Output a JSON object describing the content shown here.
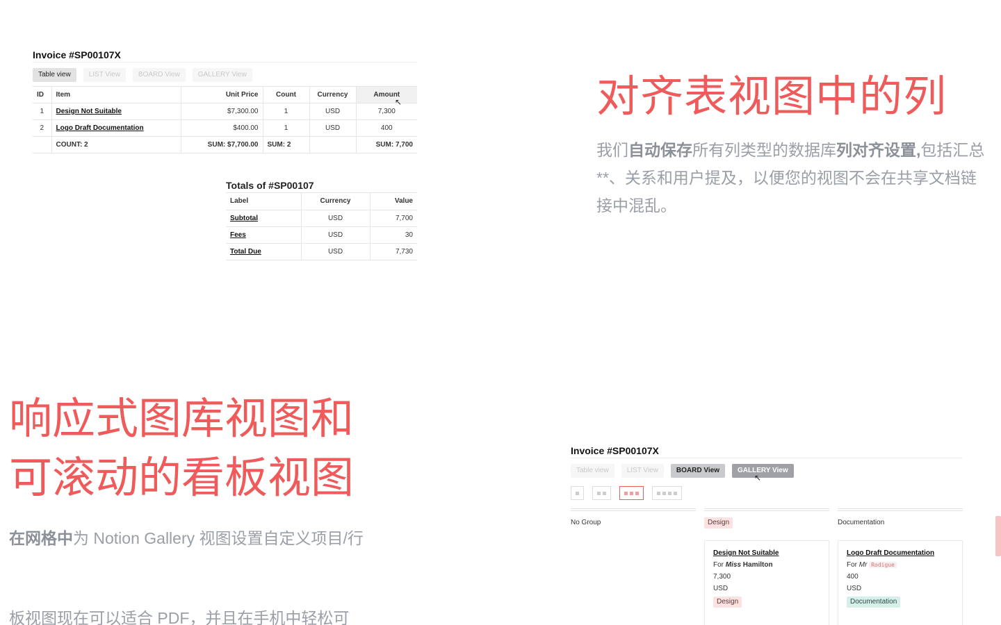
{
  "invoice_table": {
    "title": "Invoice #SP00107X",
    "tabs": [
      "Table view",
      "LIST View",
      "BOARD View",
      "GALLERY View"
    ],
    "columns": [
      "ID",
      "Item",
      "Unit Price",
      "Count",
      "Currency",
      "Amount"
    ],
    "rows": [
      {
        "id": "1",
        "item": "Design Not Suitable",
        "unit_price": "$7,300.00",
        "count": "1",
        "currency": "USD",
        "amount": "7,300"
      },
      {
        "id": "2",
        "item": "Logo Draft Documentation",
        "unit_price": "$400.00",
        "count": "1",
        "currency": "USD",
        "amount": "400"
      }
    ],
    "footer": {
      "item": "COUNT:  2",
      "unit_price": "SUM:  $7,700.00",
      "count": "SUM:  2",
      "amount": "SUM:  7,700"
    }
  },
  "totals_table": {
    "title": "Totals of #SP00107",
    "columns": [
      "Label",
      "Currency",
      "Value"
    ],
    "rows": [
      {
        "label": "Subtotal",
        "currency": "USD",
        "value": "7,700"
      },
      {
        "label": "Fees",
        "currency": "USD",
        "value": "30"
      },
      {
        "label": "Total Due",
        "currency": "USD",
        "value": "7,730"
      }
    ]
  },
  "section1": {
    "heading": "对齐表视图中的列",
    "desc_pre": "我们",
    "desc_bold1": "自动保存",
    "desc_mid": "所有列类型的数据库",
    "desc_bold2": "列对齐设置,",
    "desc_post": "包括汇总**、关系和用户提及，以便您的视图不会在共享文档链接中混乱。"
  },
  "section2": {
    "heading_line1": "响应式图库视图和",
    "heading_line2": "可滚动的看板视图",
    "desc_bold": "在网格中",
    "desc_rest": "为 Notion Gallery 视图设置自定义项目/行",
    "desc2": "板视图现在可以适合 PDF，并且在手机中轻松可"
  },
  "board": {
    "title": "Invoice #SP00107X",
    "tabs": [
      "Table view",
      "LIST View",
      "BOARD View",
      "GALLERY View"
    ],
    "groups": [
      {
        "label": "No Group"
      },
      {
        "label": "Design"
      },
      {
        "label": "Documentation"
      }
    ],
    "cards": [
      {
        "title": "Design Not Suitable",
        "for_pre": "For",
        "for_title": "Miss",
        "for_name": "Hamilton",
        "amount": "7,300",
        "currency": "USD",
        "tag": "Design"
      },
      {
        "title": "Logo Draft Documentation",
        "for_pre": "For",
        "for_title": "Mr",
        "for_name": "Rodigue",
        "amount": "400",
        "currency": "USD",
        "tag": "Documentation"
      }
    ]
  },
  "colors": {
    "accent": "#ef5b5b",
    "muted_text": "#9a9fa7"
  }
}
